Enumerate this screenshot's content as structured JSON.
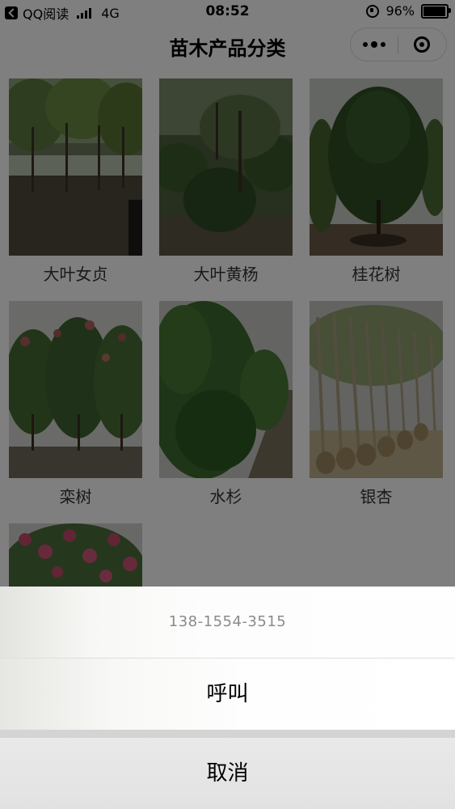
{
  "status_bar": {
    "carrier": "QQ阅读",
    "network": "4G",
    "time": "08:52",
    "battery": "96%",
    "battery_level": 0.96
  },
  "nav": {
    "title": "苗木产品分类"
  },
  "products": [
    {
      "name": "大叶女贞",
      "image_icon": "tree-row-photo"
    },
    {
      "name": "大叶黄杨",
      "image_icon": "shrub-garden-photo"
    },
    {
      "name": "桂花树",
      "image_icon": "osmanthus-tree-photo"
    },
    {
      "name": "栾树",
      "image_icon": "koelreuteria-tree-photo"
    },
    {
      "name": "水杉",
      "image_icon": "metasequoia-row-photo"
    },
    {
      "name": "银杏",
      "image_icon": "ginkgo-saplings-photo"
    },
    {
      "name": "",
      "image_icon": "crape-myrtle-photo"
    }
  ],
  "action_sheet": {
    "phone": "138-1554-3515",
    "call_label": "呼叫",
    "cancel_label": "取消"
  },
  "colors": {
    "mask": "#000000",
    "sheet_bg": "#f2f2f2"
  }
}
